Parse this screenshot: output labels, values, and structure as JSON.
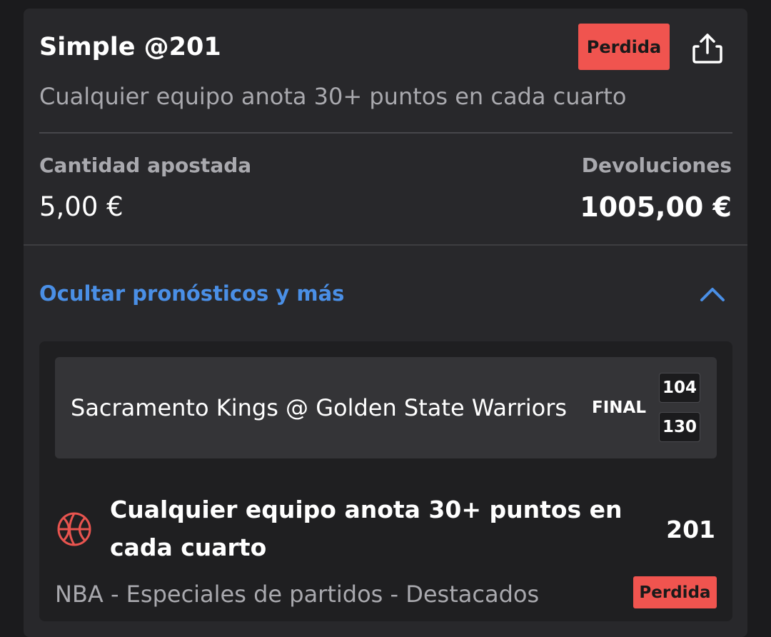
{
  "header": {
    "title": "Simple @201",
    "status": "Perdida",
    "share_icon": "share-icon",
    "subtitle": "Cualquier equipo anota 30+ puntos en cada cuarto"
  },
  "summary": {
    "stake_label": "Cantidad apostada",
    "stake_value": "5,00 €",
    "returns_label": "Devoluciones",
    "returns_value": "1005,00 €"
  },
  "toggle": {
    "label": "Ocultar pronósticos y más",
    "icon": "chevron-up-icon"
  },
  "selection": {
    "event": {
      "name": "Sacramento Kings @ Golden State Warriors",
      "status": "FINAL",
      "score_top": "104",
      "score_bottom": "130"
    },
    "sport_icon": "basketball-icon",
    "market_title": "Cualquier equipo anota 30+ puntos en cada cuarto",
    "odds": "201",
    "market_path": "NBA - Especiales de partidos - Destacados",
    "status": "Perdida"
  },
  "colors": {
    "background": "#1b1b1d",
    "card": "#28282b",
    "lost_badge": "#f0544f",
    "link": "#4a8fe6",
    "muted_text": "#a9a9ae"
  }
}
